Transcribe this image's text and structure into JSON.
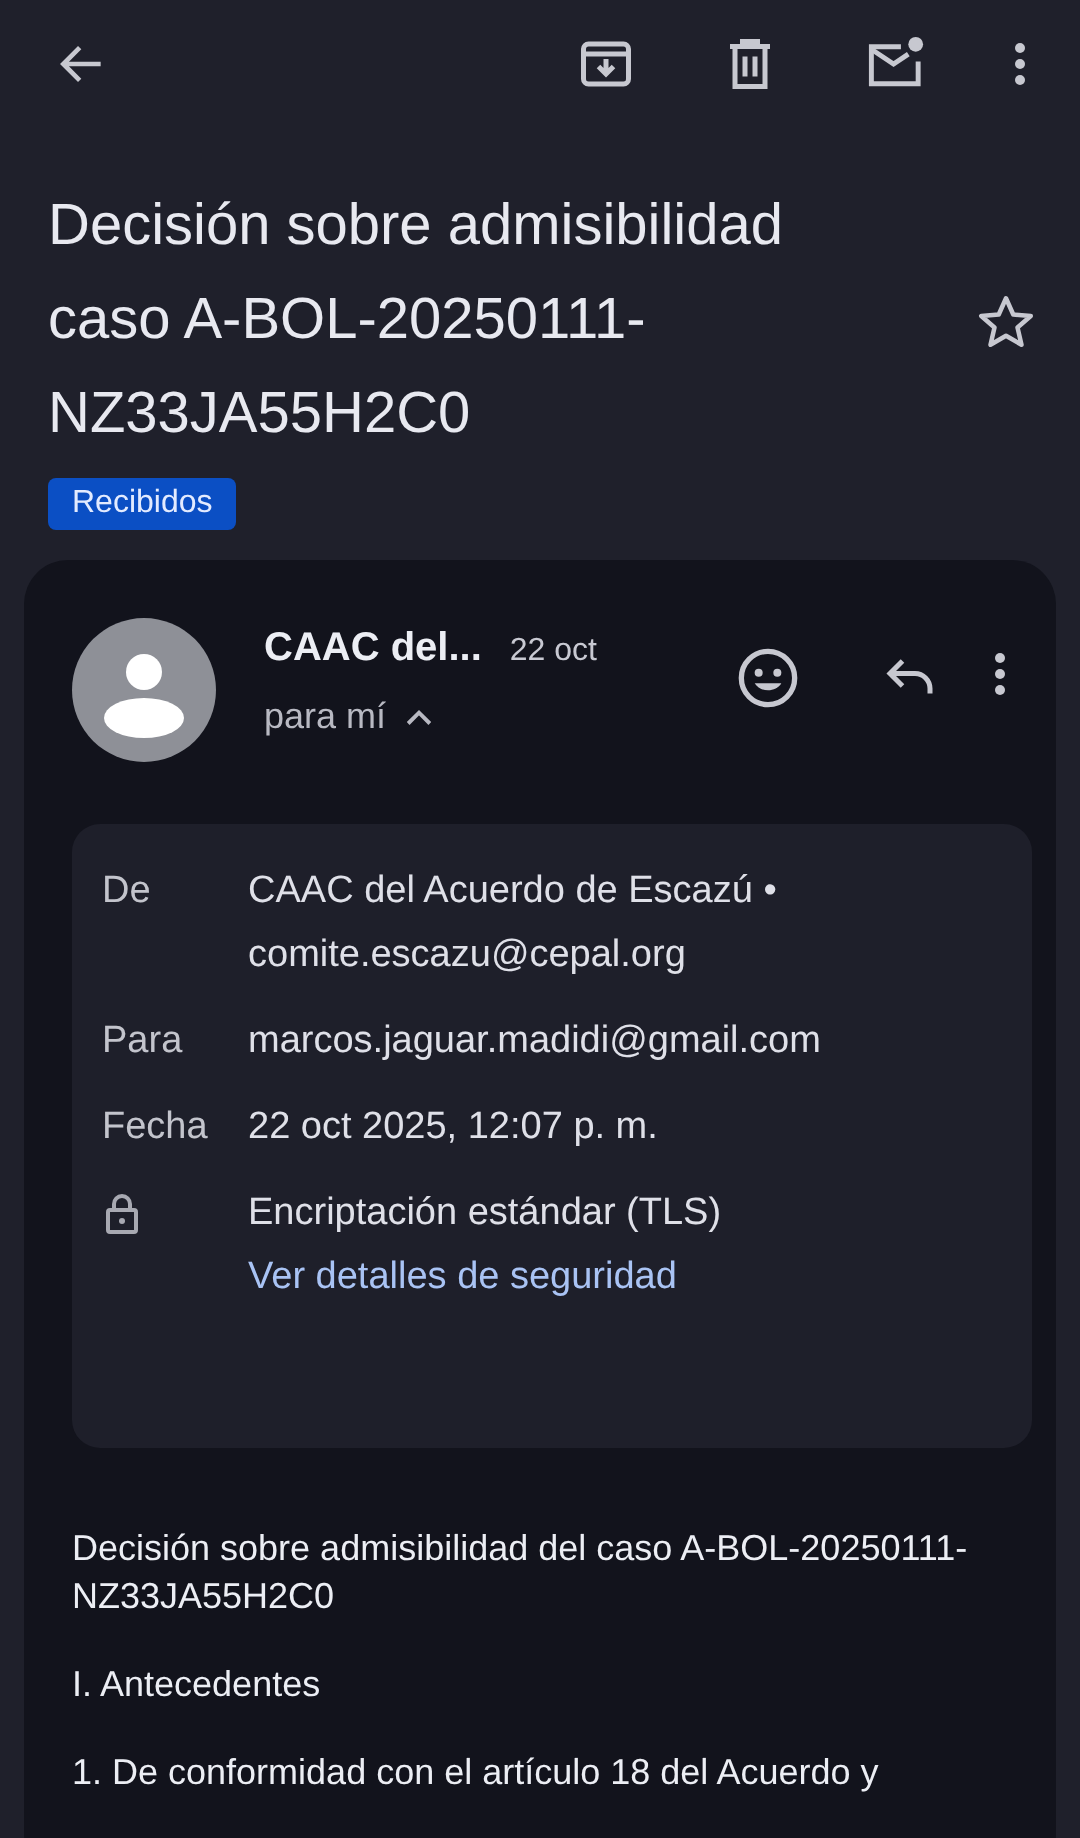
{
  "subject": {
    "title": "Decisión sobre admisibilidad caso A-BOL-20250111-NZ33JA55H2C0",
    "starred": false,
    "label": "Recibidos"
  },
  "message": {
    "sender": "CAAC del...",
    "date": "22 oct",
    "recipient": "para mí",
    "details_expanded": true,
    "details": [
      {
        "kind": "text",
        "label": "De",
        "lines": [
          "CAAC del Acuerdo de Escazú •",
          "comite.escazu@cepal.org"
        ]
      },
      {
        "kind": "text",
        "label": "Para",
        "lines": [
          "marcos.jaguar.madidi@gmail.com"
        ]
      },
      {
        "kind": "text",
        "label": "Fecha",
        "lines": [
          "22 oct 2025, 12:07 p. m."
        ]
      },
      {
        "kind": "lock",
        "lines": [
          "Encriptación estándar (TLS)"
        ],
        "link": "Ver detalles de seguridad"
      }
    ],
    "body": [
      "Decisión sobre admisibilidad del caso A-BOL-20250111-NZ33JA55H2C0",
      "I. Antecedentes",
      "1. De conformidad con el artículo 18 del Acuerdo y"
    ]
  }
}
